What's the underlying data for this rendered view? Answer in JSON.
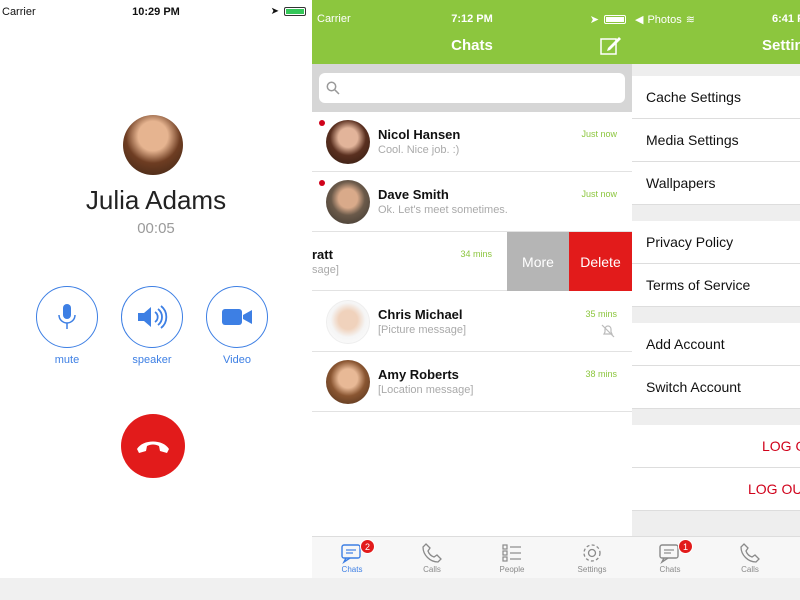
{
  "call": {
    "status_bar": {
      "carrier": "Carrier",
      "time": "10:29 PM"
    },
    "caller_name": "Julia Adams",
    "duration": "00:05",
    "buttons": [
      {
        "label": "mute",
        "icon": "microphone-icon"
      },
      {
        "label": "speaker",
        "icon": "speaker-icon"
      },
      {
        "label": "Video",
        "icon": "video-camera-icon"
      }
    ],
    "hangup_icon": "hang-up-icon",
    "colors": {
      "accent": "#3d7fe4",
      "hangup": "#e21b1b"
    }
  },
  "chats": {
    "status_bar": {
      "carrier": "Carrier",
      "time": "7:12 PM"
    },
    "title": "Chats",
    "search": {
      "placeholder": ""
    },
    "rows": [
      {
        "name": "Nicol Hansen",
        "message": "Cool. Nice job. :)",
        "time": "Just now",
        "unread": true
      },
      {
        "name": "Dave Smith",
        "message": "Ok. Let's meet sometimes.",
        "time": "Just now",
        "unread": true
      },
      {
        "name": "ratt",
        "message": "sage]",
        "time": "34 mins",
        "unread": false
      },
      {
        "name": "Chris Michael",
        "message": "[Picture message]",
        "time": "35 mins",
        "muted": true
      },
      {
        "name": "Amy Roberts",
        "message": "[Location message]",
        "time": "38 mins"
      }
    ],
    "swipe_actions": {
      "more": "More",
      "delete": "Delete"
    },
    "tabs": [
      {
        "label": "Chats",
        "badge": "2",
        "active": true
      },
      {
        "label": "Calls"
      },
      {
        "label": "People"
      },
      {
        "label": "Settings"
      }
    ],
    "colors": {
      "header": "#8cc63e",
      "time": "#8cc63e",
      "delete": "#e21b1b",
      "more": "#b5b5b5"
    }
  },
  "settings": {
    "status_bar": {
      "back_app": "Photos",
      "time": "6:41 P"
    },
    "title": "Settin",
    "rows": [
      "Cache Settings",
      "Media Settings",
      "Wallpapers",
      "Privacy Policy",
      "Terms of Service",
      "Add Account",
      "Switch Account"
    ],
    "logout_rows": [
      "LOG O",
      "LOG OUT"
    ],
    "tabs": [
      {
        "label": "Chats",
        "badge": "1"
      },
      {
        "label": "Calls"
      }
    ]
  }
}
